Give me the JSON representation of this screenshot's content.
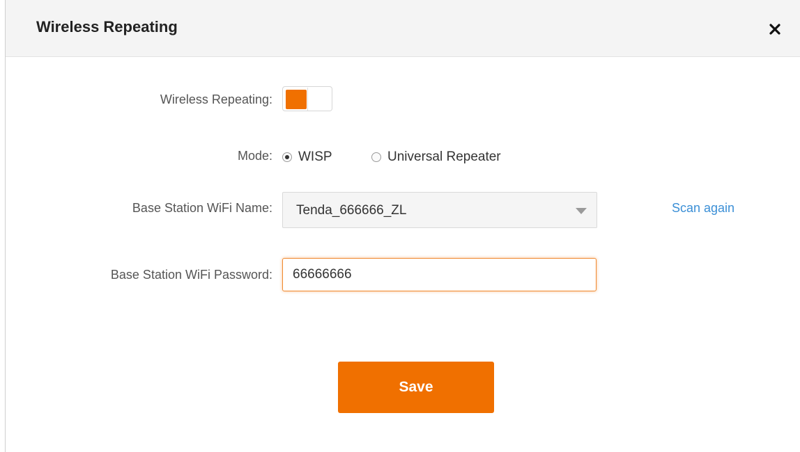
{
  "dialog": {
    "title": "Wireless Repeating",
    "close_icon": "close-icon"
  },
  "form": {
    "wireless_repeating": {
      "label": "Wireless Repeating:",
      "enabled": true
    },
    "mode": {
      "label": "Mode:",
      "options": [
        "WISP",
        "Universal Repeater"
      ],
      "selected": "WISP"
    },
    "base_station_name": {
      "label": "Base Station WiFi Name:",
      "value": "Tenda_666666_ZL",
      "scan_label": "Scan again"
    },
    "base_station_password": {
      "label": "Base Station WiFi Password:",
      "value": "66666666"
    },
    "save_label": "Save"
  },
  "colors": {
    "accent": "#f07000",
    "link": "#3b8fd6"
  }
}
